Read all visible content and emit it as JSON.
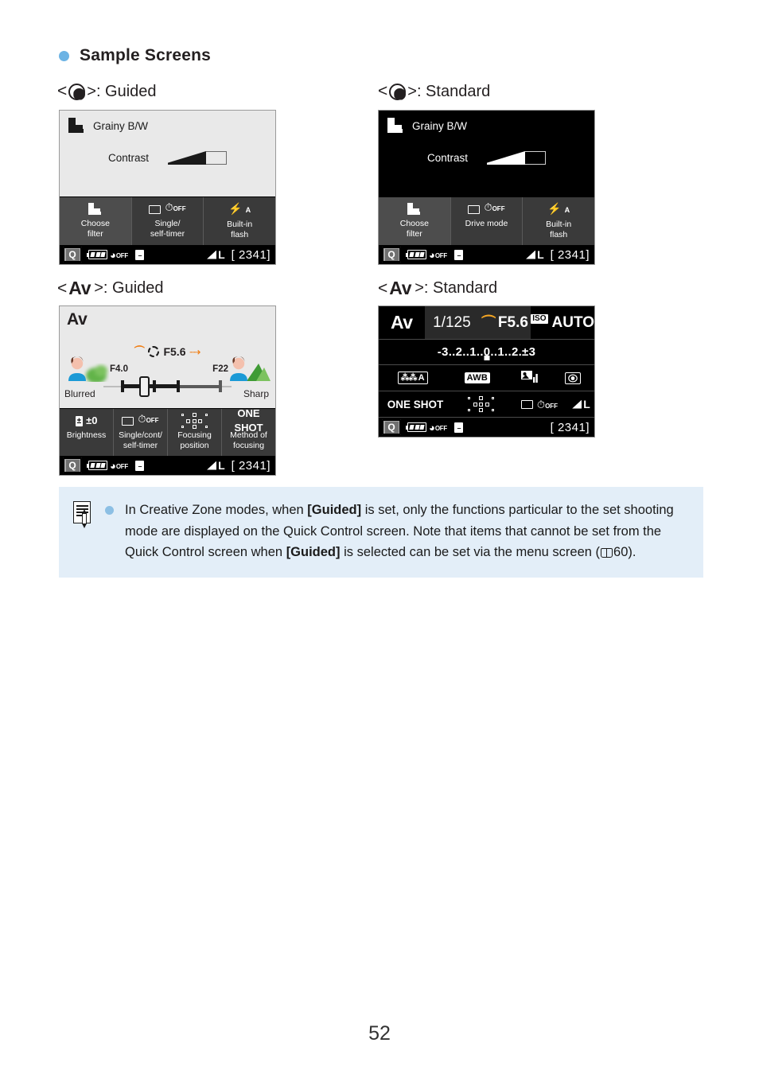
{
  "section": {
    "title": "Sample Screens",
    "bullet_color": "#6cb3e4"
  },
  "captions": {
    "guided_filter": {
      "prefix": "<",
      "icon": "display-level-dial-icon",
      "suffix": ">: Guided"
    },
    "standard_filter": {
      "prefix": "<",
      "icon": "display-level-dial-icon",
      "suffix": ">: Standard"
    },
    "guided_av": {
      "prefix": "<",
      "mode": "Av",
      "suffix": ">: Guided"
    },
    "standard_av": {
      "prefix": "<",
      "mode": "Av",
      "suffix": ">: Standard"
    }
  },
  "screens": {
    "filter_guided": {
      "filter_name": "Grainy B/W",
      "contrast_label": "Contrast",
      "contrast_fill_percent": 65,
      "quick_control": [
        {
          "icon": "creative-filter-icon",
          "label": "Choose\nfilter",
          "label_line1": "Choose",
          "label_line2": "filter",
          "selected": true
        },
        {
          "icon": "drive-mode-icon",
          "label_line1": "Single/",
          "label_line2": "self-timer",
          "selected": false
        },
        {
          "icon": "built-in-flash-icon",
          "label_line1": "Built-in",
          "label_line2": "flash",
          "selected": false
        }
      ],
      "status_bar": {
        "q_button": "Q",
        "battery": "battery-icon",
        "wifi": "OFF",
        "bluetooth": "bluetooth-icon",
        "quality": "L",
        "shots": "[ 2341]"
      }
    },
    "filter_standard": {
      "filter_name": "Grainy B/W",
      "contrast_label": "Contrast",
      "contrast_fill_percent": 65,
      "quick_control": [
        {
          "icon": "creative-filter-icon",
          "label_line1": "Choose",
          "label_line2": "filter",
          "selected": true
        },
        {
          "icon": "drive-mode-icon",
          "label_line1": "Drive mode",
          "label_line2": "",
          "selected": false
        },
        {
          "icon": "built-in-flash-icon",
          "label_line1": "Built-in",
          "label_line2": "flash",
          "selected": false
        }
      ],
      "status_bar": {
        "q_button": "Q",
        "wifi": "OFF",
        "quality": "L",
        "shots": "[ 2341]"
      }
    },
    "av_guided": {
      "mode": "Av",
      "aperture_current": "F5.6",
      "aperture_min": "F4.0",
      "aperture_max": "F22",
      "left_label": "Blurred",
      "right_label": "Sharp",
      "quick_control": [
        {
          "icon": "exposure-compensation-icon",
          "value": "±0",
          "label_line1": "Brightness",
          "label_line2": ""
        },
        {
          "icon": "drive-mode-icon",
          "value": "",
          "label_line1": "Single/cont/",
          "label_line2": "self-timer"
        },
        {
          "icon": "af-point-grid-icon",
          "value": "",
          "label_line1": "Focusing",
          "label_line2": "position"
        },
        {
          "icon": "af-method-text",
          "value": "ONE SHOT",
          "label_line1": "Method of",
          "label_line2": "focusing"
        }
      ],
      "status_bar": {
        "q_button": "Q",
        "wifi": "OFF",
        "quality": "L",
        "shots": "[ 2341]"
      }
    },
    "av_standard": {
      "mode": "Av",
      "shutter": "1/125",
      "aperture": "F5.6",
      "iso_label": "ISO",
      "iso_value": "AUTO",
      "exposure_scale": "-3..2..1..0..1..2.±3",
      "row_picture": [
        {
          "icon": "picture-style-auto-icon",
          "value": "A"
        },
        {
          "icon": "white-balance-icon",
          "value": "AWB"
        },
        {
          "icon": "auto-lighting-optimizer-icon",
          "value": ""
        },
        {
          "icon": "metering-mode-icon",
          "value": ""
        }
      ],
      "row_focus": [
        {
          "icon": "af-operation-text",
          "value": "ONE SHOT"
        },
        {
          "icon": "af-point-grid-icon",
          "value": ""
        },
        {
          "icon": "drive-mode-icon",
          "value": ""
        },
        {
          "icon": "image-quality-icon",
          "value": "L"
        }
      ],
      "status_bar": {
        "q_button": "Q",
        "wifi": "OFF",
        "shots": "[ 2341]"
      }
    }
  },
  "note": {
    "icon": "note-pad-icon",
    "bullet_color": "#8cbfe4",
    "segments": [
      {
        "t": "In Creative Zone modes, when ",
        "b": false
      },
      {
        "t": "[Guided]",
        "b": true
      },
      {
        "t": " is set, only the functions particular to the set shooting mode are displayed on the Quick Control screen. Note that items that cannot be set from the Quick Control screen when ",
        "b": false
      },
      {
        "t": "[Guided]",
        "b": true
      },
      {
        "t": " is selected can be set via the menu screen (",
        "b": false
      }
    ],
    "page_ref": "60",
    "tail": ")."
  },
  "page_number": "52"
}
